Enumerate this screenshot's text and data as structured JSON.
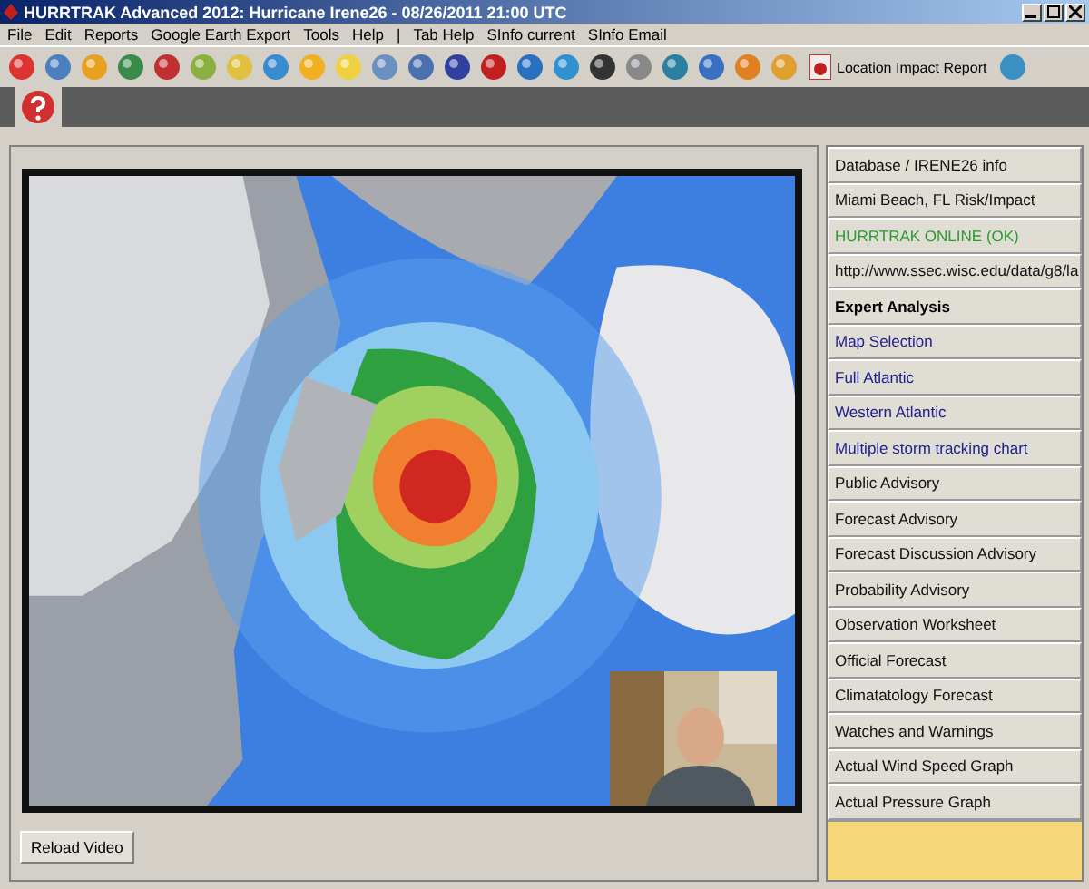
{
  "window": {
    "title": "HURRTRAK Advanced 2012: Hurricane Irene26 - 08/26/2011 21:00 UTC"
  },
  "menu": [
    {
      "label": "File"
    },
    {
      "label": "Edit"
    },
    {
      "label": "Reports"
    },
    {
      "label": "Google Earth Export"
    },
    {
      "label": "Tools"
    },
    {
      "label": "Help"
    },
    {
      "label": "|"
    },
    {
      "label": "Tab Help"
    },
    {
      "label": "SInfo current"
    },
    {
      "label": "SInfo Email"
    }
  ],
  "toolbar": {
    "report_button": "Location Impact Report"
  },
  "sidebar": {
    "items": [
      {
        "label": "Database / IRENE26 info",
        "kind": "item"
      },
      {
        "label": "Miami Beach, FL Risk/Impact",
        "kind": "item"
      },
      {
        "label": "HURRTRAK ONLINE (OK)",
        "kind": "status"
      },
      {
        "label": "http://www.ssec.wisc.edu/data/g8/la",
        "kind": "item"
      },
      {
        "label": "Expert Analysis",
        "kind": "header"
      },
      {
        "label": "Map Selection",
        "kind": "map"
      },
      {
        "label": "Full Atlantic",
        "kind": "map"
      },
      {
        "label": "Western Atlantic",
        "kind": "map"
      },
      {
        "label": "Multiple storm tracking chart",
        "kind": "map"
      },
      {
        "label": "Public Advisory",
        "kind": "item"
      },
      {
        "label": "Forecast Advisory",
        "kind": "item"
      },
      {
        "label": "Forecast Discussion Advisory",
        "kind": "item"
      },
      {
        "label": "Probability Advisory",
        "kind": "item"
      },
      {
        "label": "Observation Worksheet",
        "kind": "item"
      },
      {
        "label": "Official Forecast",
        "kind": "item"
      },
      {
        "label": "Climatatology Forecast",
        "kind": "item"
      },
      {
        "label": "Watches and Warnings",
        "kind": "item"
      },
      {
        "label": "Actual Wind Speed Graph",
        "kind": "item"
      },
      {
        "label": "Actual Pressure Graph",
        "kind": "item"
      }
    ]
  },
  "reload_button": "Reload Video"
}
